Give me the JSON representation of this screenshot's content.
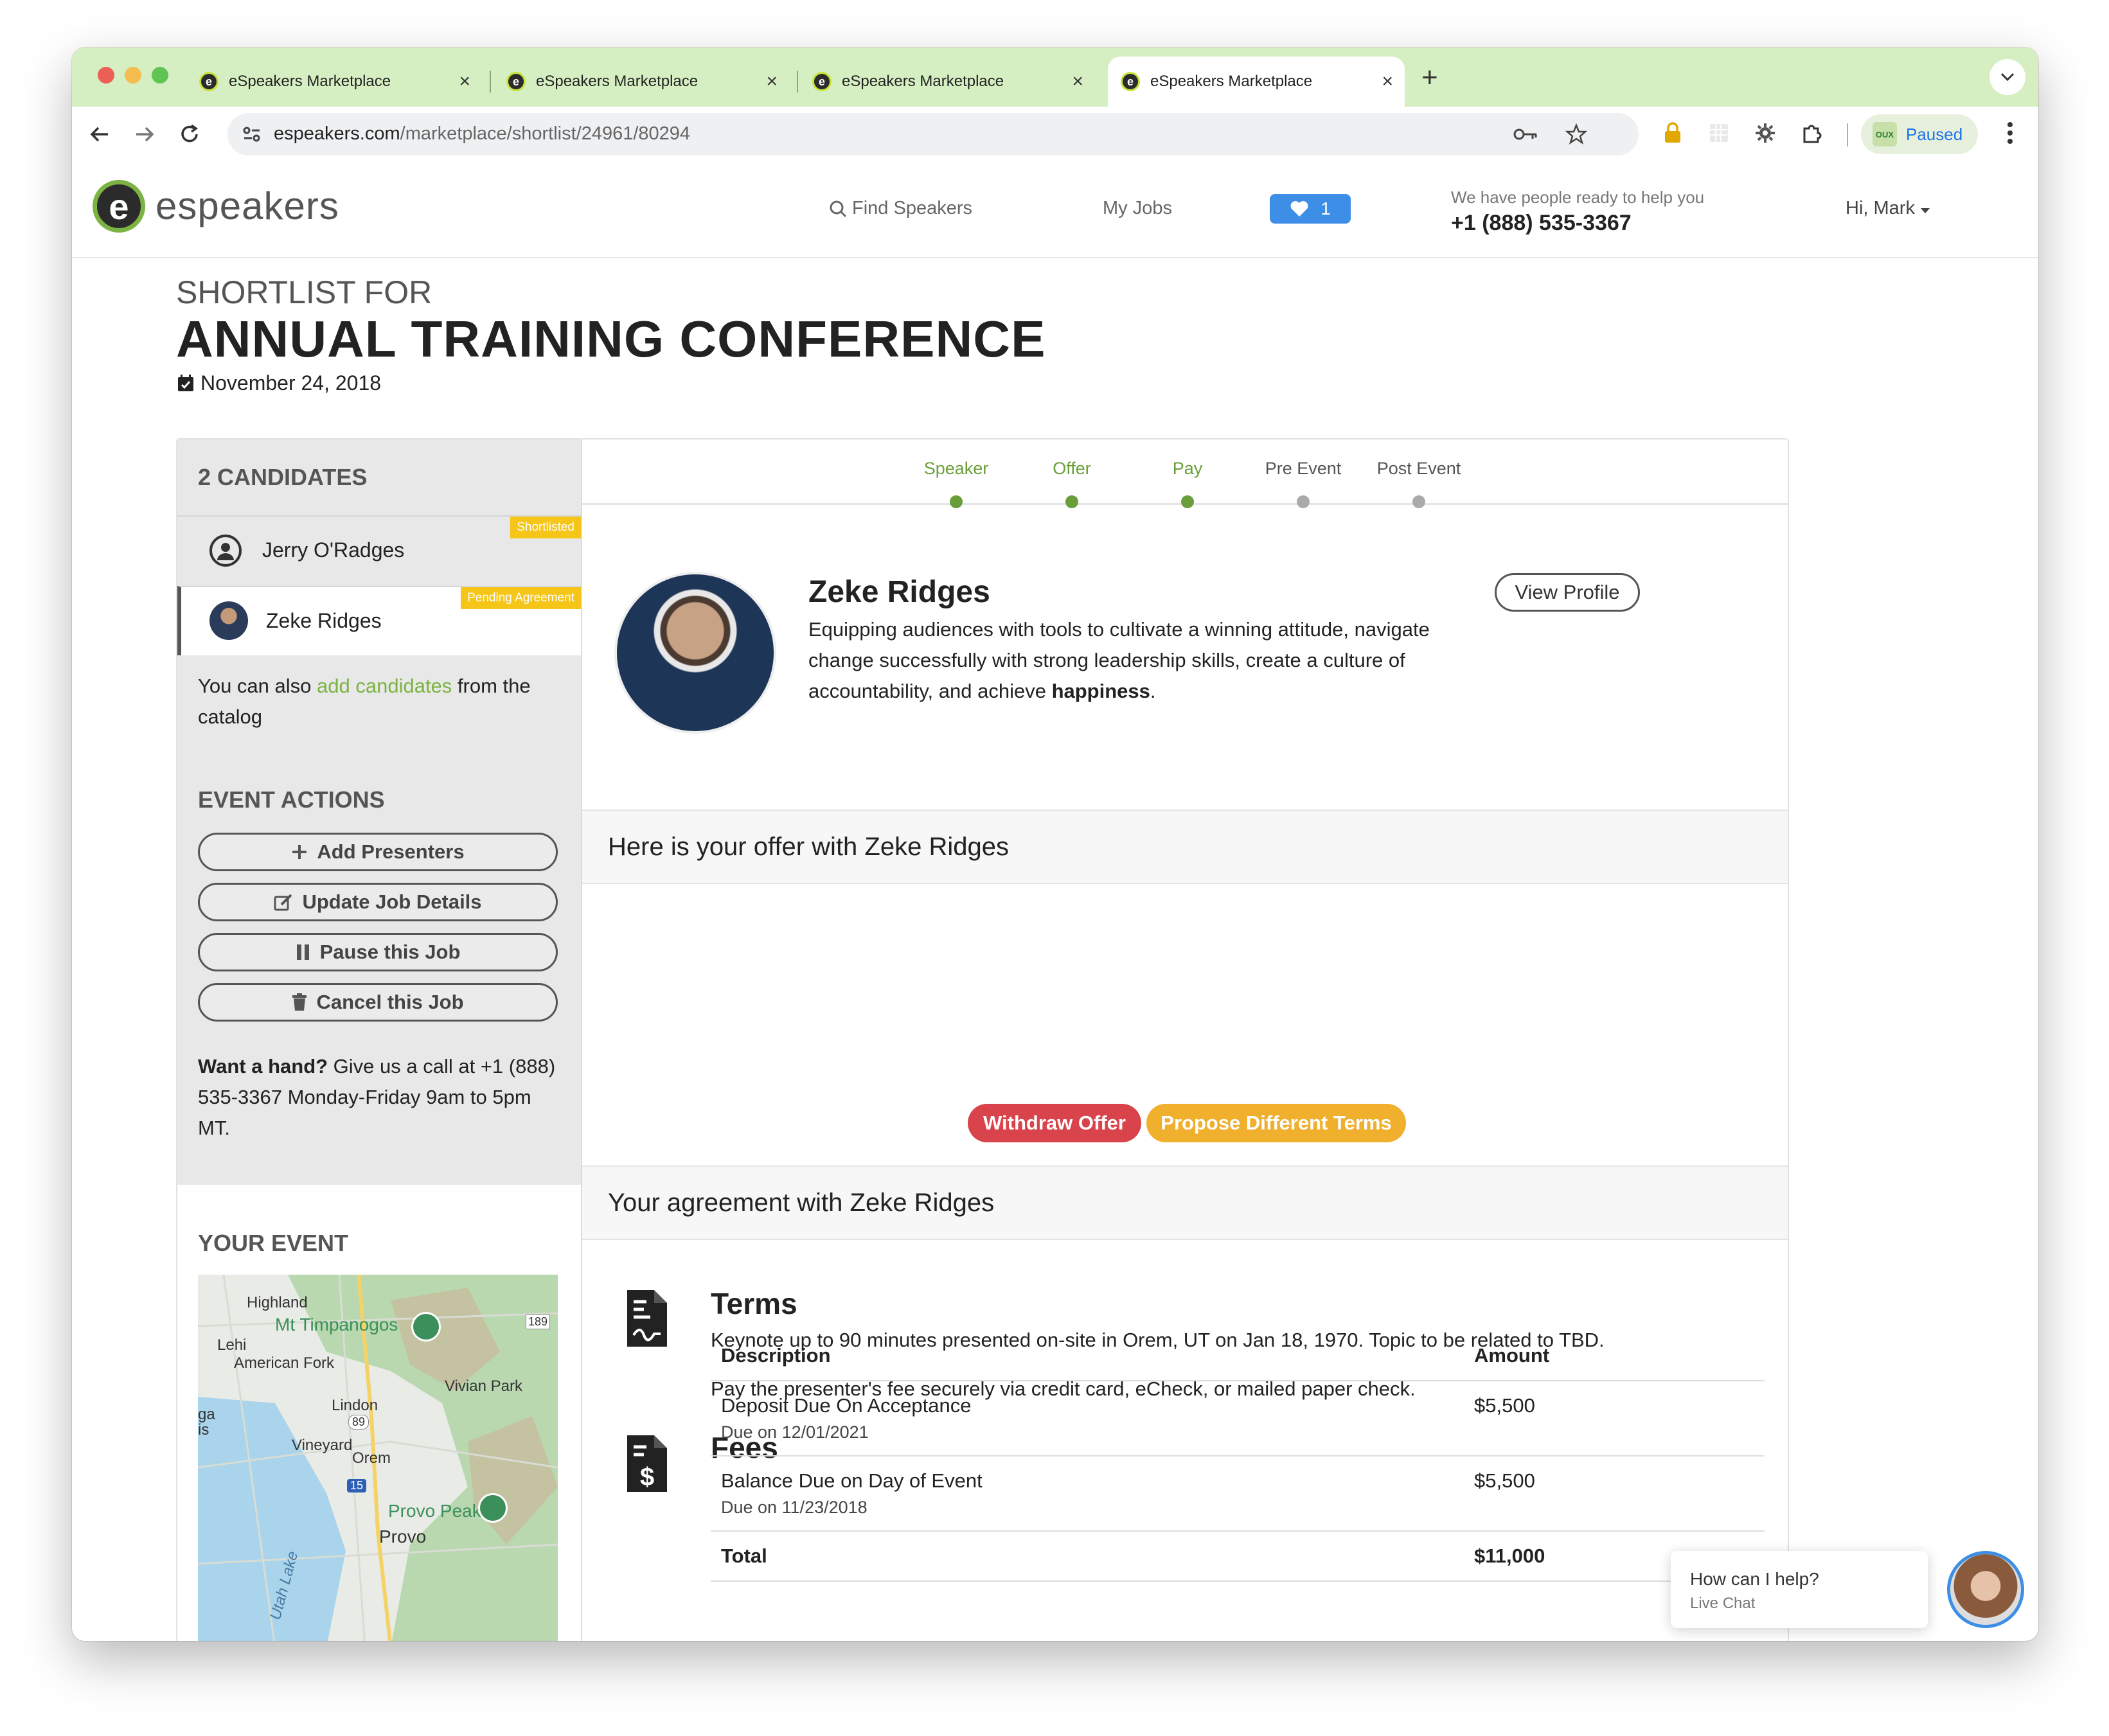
{
  "browser": {
    "tabs": [
      {
        "title": "eSpeakers Marketplace"
      },
      {
        "title": "eSpeakers Marketplace"
      },
      {
        "title": "eSpeakers Marketplace"
      },
      {
        "title": "eSpeakers Marketplace"
      }
    ],
    "url_domain": "espeakers.com",
    "url_path": "/marketplace/shortlist/24961/80294",
    "profile_status": "Paused",
    "profile_badge": "OUX"
  },
  "site_header": {
    "logo_letter": "e",
    "logo_text": "espeakers",
    "find_speakers": "Find Speakers",
    "my_jobs": "My Jobs",
    "favorites_count": "1",
    "help_sub": "We have people ready to help you",
    "help_phone": "+1 (888) 535-3367",
    "greeting": "Hi, Mark"
  },
  "page": {
    "shortlist_for": "SHORTLIST FOR",
    "event_title": "ANNUAL TRAINING CONFERENCE",
    "event_date": "November 24, 2018"
  },
  "sidebar": {
    "candidates_heading": "2 CANDIDATES",
    "candidates": [
      {
        "name": "Jerry O'Radges",
        "badge": "Shortlisted"
      },
      {
        "name": "Zeke Ridges",
        "badge": "Pending Agreement"
      }
    ],
    "add_text_prefix": "You can also ",
    "add_link": "add candidates",
    "add_text_suffix": " from the catalog",
    "event_actions_heading": "EVENT ACTIONS",
    "actions": [
      {
        "label": "Add Presenters"
      },
      {
        "label": "Update Job Details"
      },
      {
        "label": "Pause this Job"
      },
      {
        "label": "Cancel this Job"
      }
    ],
    "help_bold": "Want a hand?",
    "help_text": " Give us a call at +1 (888) 535-3367 Monday-Friday 9am to 5pm MT.",
    "your_event_heading": "YOUR EVENT",
    "map_labels": {
      "highland": "Highland",
      "timpanogos": "Mt Timpanogos",
      "lehi": "Lehi",
      "american_fork": "American Fork",
      "vivian_park": "Vivian Park",
      "lindon": "Lindon",
      "vineyard": "Vineyard",
      "orem": "Orem",
      "provo_peak": "Provo Peak",
      "provo": "Provo",
      "utah_lake": "Utah Lake",
      "ga": "ga",
      "is": "is",
      "hwy189": "189",
      "hwy89": "89",
      "i15": "15"
    }
  },
  "steps": [
    {
      "label": "Speaker",
      "done": true
    },
    {
      "label": "Offer",
      "done": true
    },
    {
      "label": "Pay",
      "done": true
    },
    {
      "label": "Pre Event",
      "done": false
    },
    {
      "label": "Post Event",
      "done": false
    }
  ],
  "speaker": {
    "name": "Zeke Ridges",
    "desc_main": "Equipping audiences with tools to cultivate a winning attitude, navigate change successfully with strong leadership skills, create a culture of accountability, and achieve ",
    "desc_bold": "happiness",
    "desc_end": ".",
    "view_profile": "View Profile"
  },
  "offer": {
    "heading": "Here is your offer with Zeke Ridges",
    "withdraw": "Withdraw Offer",
    "propose": "Propose Different Terms"
  },
  "agreement": {
    "heading": "Your agreement with Zeke Ridges",
    "terms_title": "Terms",
    "terms_line1": "Keynote up to 90 minutes presented on-site in Orem, UT on Jan 18, 1970. Topic to be related to TBD.",
    "terms_line2": "Pay the presenter's fee securely via credit card, eCheck, or mailed paper check.",
    "fees_title": "Fees",
    "fees_header": {
      "description": "Description",
      "amount": "Amount"
    },
    "fees_rows": [
      {
        "description": "Deposit Due On Acceptance",
        "due": "Due on 12/01/2021",
        "amount": "$5,500"
      },
      {
        "description": "Balance Due on Day of Event",
        "due": "Due on 11/23/2018",
        "amount": "$5,500"
      }
    ],
    "total_label": "Total",
    "total_amount": "$11,000"
  },
  "chat": {
    "question": "How can I help?",
    "sub": "Live Chat"
  },
  "colors": {
    "brand_green": "#7cb342",
    "step_done": "#6a9e3a",
    "withdraw": "#d9434b",
    "propose": "#f0b02e",
    "shortlisted_badge": "#f5c518",
    "pending_badge": "#f5c518",
    "heart_button": "#3d8ee6"
  }
}
